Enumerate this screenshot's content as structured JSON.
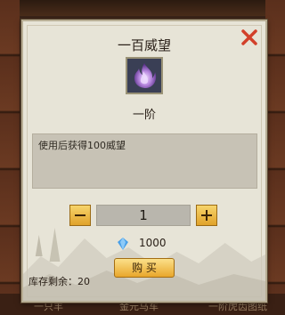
{
  "popup": {
    "title": "一百威望",
    "item_grade": "一阶",
    "description": "使用后获得100威望",
    "quantity": "1",
    "cost": "1000",
    "buy_label": "购 买",
    "stock_text": "库存剩余：20",
    "item_icon": "purple-flame-icon",
    "currency_icon": "blue-gem-icon",
    "close_icon": "close-x-icon"
  },
  "background": {
    "labels": [
      "一只羊",
      "金元马车",
      "一阶虎齿图纸"
    ]
  },
  "colors": {
    "close_red": "#d2402a",
    "button_gold": "#e9a72c",
    "flame_purple": "#b98ae0",
    "gem_blue": "#4aa0e8"
  }
}
